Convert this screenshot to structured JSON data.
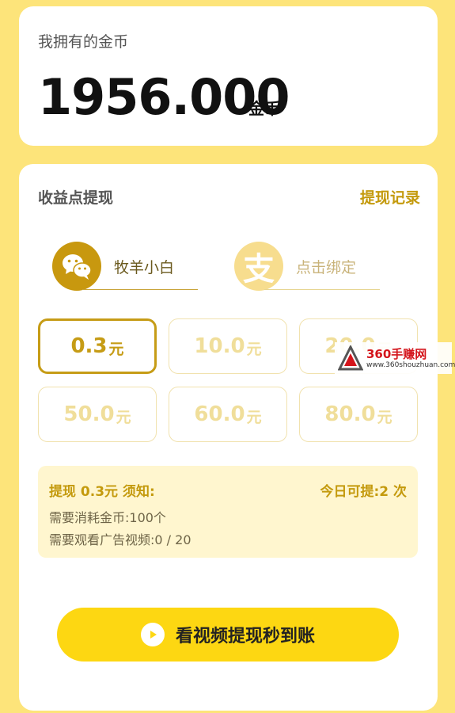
{
  "coins": {
    "title": "我拥有的金币",
    "amount": "1956.000",
    "unit": "金币"
  },
  "withdraw": {
    "title": "收益点提现",
    "records_link": "提现记录",
    "accounts": [
      {
        "name": "牧羊小白",
        "icon": "wechat-icon"
      },
      {
        "name": "点击绑定",
        "icon": "alipay-icon"
      }
    ],
    "amounts": [
      {
        "value": "0.3",
        "unit": "元",
        "selected": true
      },
      {
        "value": "10.0",
        "unit": "元",
        "selected": false
      },
      {
        "value": "20.0",
        "unit": "元",
        "selected": false
      },
      {
        "value": "50.0",
        "unit": "元",
        "selected": false
      },
      {
        "value": "60.0",
        "unit": "元",
        "selected": false
      },
      {
        "value": "80.0",
        "unit": "元",
        "selected": false
      }
    ],
    "notice": {
      "title": "提现 0.3元 须知:",
      "today": "今日可提:2 次",
      "line1": "需要消耗金币:100个",
      "line2": "需要观看广告视频:0 / 20"
    },
    "cta_label": "看视频提现秒到账"
  },
  "watermark": {
    "brand": "360手赚网",
    "url": "www.360shouzhuan.com"
  },
  "colors": {
    "page_background": "#fde47a",
    "accent": "#c69c16",
    "cta": "#fdd712"
  }
}
